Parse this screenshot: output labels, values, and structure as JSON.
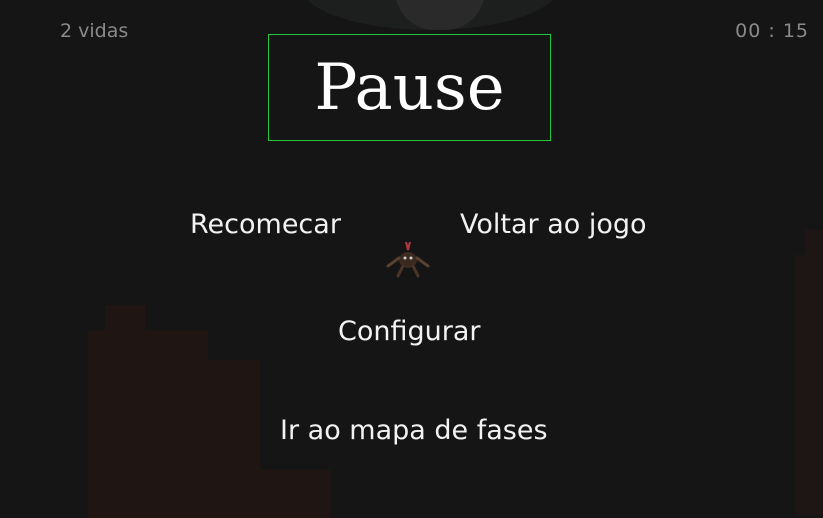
{
  "hud": {
    "lives": "2 vidas",
    "timer": "00 : 15"
  },
  "pause_menu": {
    "title": "Pause",
    "options": {
      "restart": "Recomecar",
      "resume": "Voltar ao jogo",
      "settings": "Configurar",
      "map": "Ir ao mapa de fases"
    }
  },
  "colors": {
    "background": "#151515",
    "title_border": "#21c93a",
    "text": "#f2f2f2",
    "hud_text": "#8a8a8a"
  },
  "icons": {
    "selector": "player-character-sprite"
  }
}
